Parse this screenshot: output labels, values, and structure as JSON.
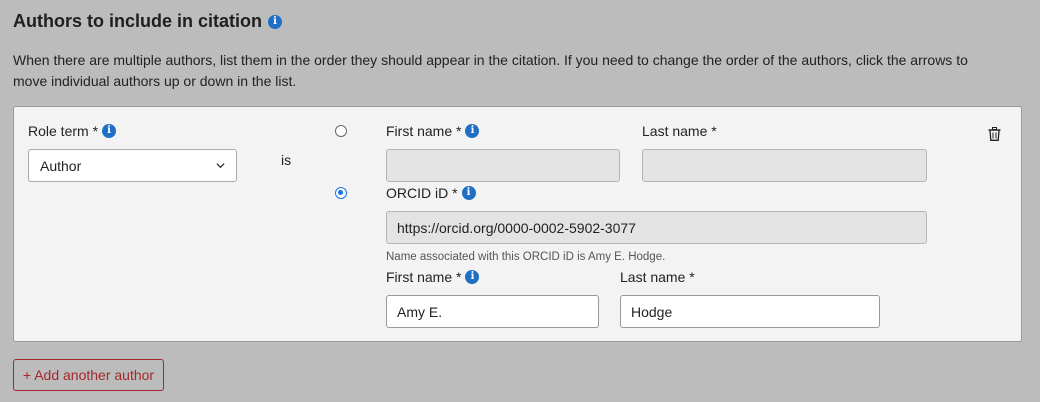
{
  "section": {
    "title": "Authors to include in citation",
    "intro": "When there are multiple authors, list them in the order they should appear in the citation. If you need to change the order of the authors, click the arrows to move individual authors up or down in the list."
  },
  "author": {
    "role_label": "Role term *",
    "role_value": "Author",
    "is_text": "is",
    "name_option": {
      "selected": false,
      "first_label": "First name *",
      "first_value": "",
      "last_label": "Last name *",
      "last_value": ""
    },
    "orcid_option": {
      "selected": true,
      "label": "ORCID iD *",
      "value": "https://orcid.org/0000-0002-5902-3077",
      "hint": "Name associated with this ORCID iD is Amy E. Hodge.",
      "first_label": "First name *",
      "first_value": "Amy E.",
      "last_label": "Last name *",
      "last_value": "Hodge"
    }
  },
  "add_button_label": "+ Add another author",
  "icons": {
    "info": "info-icon",
    "trash": "trash-icon",
    "chevron": "chevron-down-icon"
  },
  "colors": {
    "info_blue": "#1f6fc5",
    "radio_blue": "#1a73e8",
    "add_button": "#a4282d"
  }
}
